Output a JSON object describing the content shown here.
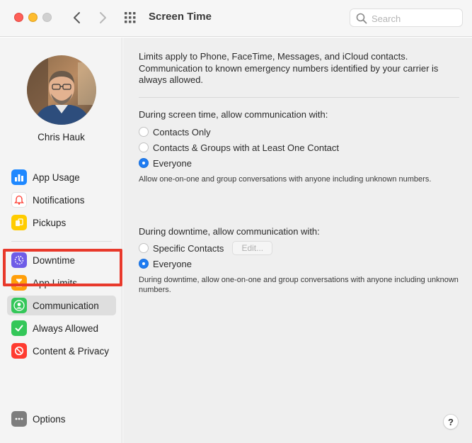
{
  "window": {
    "title": "Screen Time",
    "search_placeholder": "Search"
  },
  "sidebar": {
    "user_name": "Chris Hauk",
    "items": [
      {
        "label": "App Usage",
        "icon": "bar-chart-icon",
        "color": "#1e88ff"
      },
      {
        "label": "Notifications",
        "icon": "bell-icon",
        "color": "#ffffff"
      },
      {
        "label": "Pickups",
        "icon": "pickup-icon",
        "color": "#ffcc00"
      },
      {
        "label": "Downtime",
        "icon": "downtime-icon",
        "color": "#6e5ce7"
      },
      {
        "label": "App Limits",
        "icon": "hourglass-icon",
        "color": "#ff9f0a"
      },
      {
        "label": "Communication",
        "icon": "contact-icon",
        "color": "#34c759"
      },
      {
        "label": "Always Allowed",
        "icon": "checkmark-icon",
        "color": "#34c759"
      },
      {
        "label": "Content & Privacy",
        "icon": "restricted-icon",
        "color": "#ff3b30"
      }
    ],
    "options_label": "Options"
  },
  "main": {
    "intro": "Limits apply to Phone, FaceTime, Messages, and iCloud contacts. Communication to known emergency numbers identified by your carrier is always allowed.",
    "screen_time": {
      "title": "During screen time, allow communication with:",
      "options": [
        "Contacts Only",
        "Contacts & Groups with at Least One Contact",
        "Everyone"
      ],
      "selected": "Everyone",
      "note": "Allow one-on-one and group conversations with anyone including unknown numbers."
    },
    "downtime": {
      "title": "During downtime, allow communication with:",
      "options": [
        "Specific Contacts",
        "Everyone"
      ],
      "selected": "Everyone",
      "edit_label": "Edit...",
      "note": "During downtime, allow one-on-one and group conversations with anyone including unknown numbers."
    },
    "help_label": "?"
  },
  "colors": {
    "accent": "#1f7cf2",
    "highlight": "#e8392b"
  }
}
